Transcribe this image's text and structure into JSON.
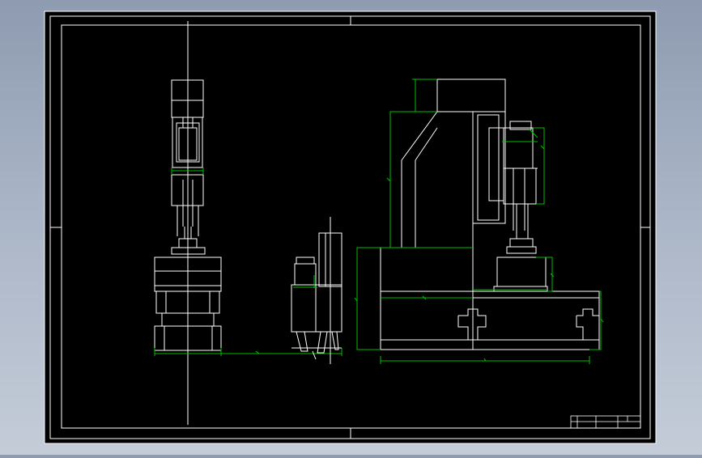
{
  "colors": {
    "canvas": "#000000",
    "background": "#9aa6ba",
    "geometry": "#ffffff",
    "dimensions": "#00c000"
  },
  "title_block": {
    "cells": [
      "",
      "",
      ""
    ]
  }
}
